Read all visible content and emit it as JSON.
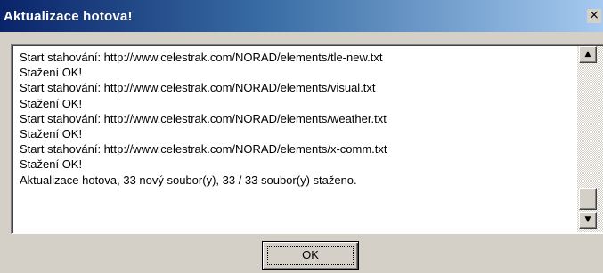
{
  "window": {
    "title": "Aktualizace hotova!",
    "close_glyph": "×"
  },
  "log": {
    "lines": [
      "Start stahování: http://www.celestrak.com/NORAD/elements/tle-new.txt",
      "Stažení OK!",
      "Start stahování: http://www.celestrak.com/NORAD/elements/visual.txt",
      "Stažení OK!",
      "Start stahování: http://www.celestrak.com/NORAD/elements/weather.txt",
      "Stažení OK!",
      "Start stahování: http://www.celestrak.com/NORAD/elements/x-comm.txt",
      "Stažení OK!",
      "Aktualizace hotova, 33 nový soubor(y), 33 / 33 soubor(y) staženo."
    ]
  },
  "scrollbar": {
    "up_glyph": "▲",
    "down_glyph": "▼"
  },
  "buttons": {
    "ok_label": "OK"
  },
  "colors": {
    "title_start": "#0a246a",
    "title_end": "#a6caf0",
    "face": "#d4d0c8"
  }
}
